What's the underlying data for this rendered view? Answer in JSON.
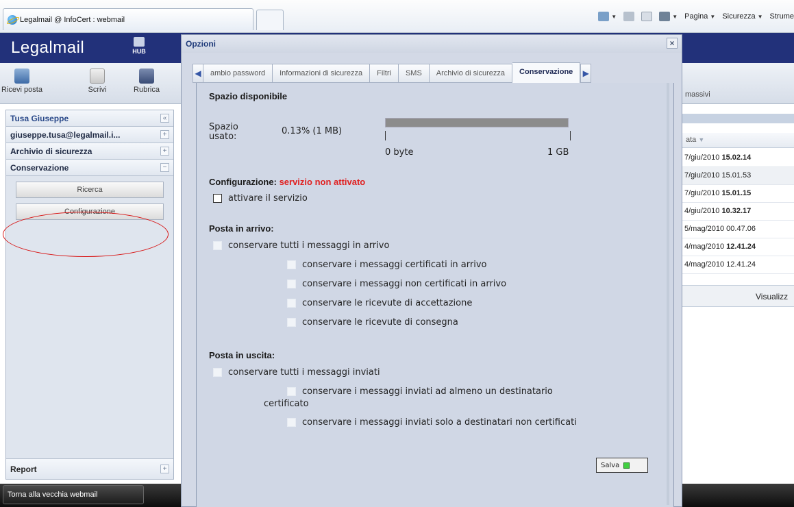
{
  "browser": {
    "tab_title": "Legalmail @ InfoCert : webmail",
    "commands": [
      "Pagina",
      "Sicurezza",
      "Strume"
    ]
  },
  "app": {
    "logo": "Legalmail",
    "hub_label": "HUB"
  },
  "toolbar": {
    "receive_label": "Ricevi posta",
    "write_label": "Scrivi",
    "contacts_label": "Rubrica",
    "massivi_label": "massivi"
  },
  "sidebar": {
    "user_name": "Tusa Giuseppe",
    "collapse_glyph": "«",
    "account": "giuseppe.tusa@legalmail.i...",
    "archive": "Archivio di sicurezza",
    "conservation": "Conservazione",
    "buttons": {
      "search": "Ricerca",
      "config": "Configurazione"
    },
    "report": "Report"
  },
  "taskbar": {
    "old_webmail": "Torna alla vecchia webmail"
  },
  "message_list": {
    "col_header": "ata",
    "rows": [
      {
        "date": "7/giu/2010",
        "time": "15.02.14",
        "bold": true
      },
      {
        "date": "7/giu/2010",
        "time": "15.01.53",
        "bold": false
      },
      {
        "date": "7/giu/2010",
        "time": "15.01.15",
        "bold": true
      },
      {
        "date": "4/giu/2010",
        "time": "10.32.17",
        "bold": true
      },
      {
        "date": "5/mag/2010",
        "time": "00.47.06",
        "bold": false
      },
      {
        "date": "4/mag/2010",
        "time": "12.41.24",
        "bold": true
      },
      {
        "date": "4/mag/2010",
        "time": "12.41.24",
        "bold": false
      }
    ],
    "visualizza": "Visualizz"
  },
  "modal": {
    "title": "Opzioni",
    "close_glyph": "×",
    "tabs": [
      {
        "label": "ambio password",
        "active": false
      },
      {
        "label": "Informazioni di sicurezza",
        "active": false
      },
      {
        "label": "Filtri",
        "active": false
      },
      {
        "label": "SMS",
        "active": false
      },
      {
        "label": "Archivio di sicurezza",
        "active": false
      },
      {
        "label": "Conservazione",
        "active": true
      }
    ],
    "space": {
      "title": "Spazio disponibile",
      "used_label_1": "Spazio",
      "used_label_2": "usato:",
      "used_value": "0.13% (1 MB)",
      "used_fraction": 0.0013,
      "min_label": "0 byte",
      "max_label": "1 GB"
    },
    "config": {
      "label": "Configurazione:",
      "status": "servizio non attivato",
      "status_color": "#e02020",
      "activate": "attivare il servizio"
    },
    "incoming": {
      "title": "Posta in arrivo:",
      "all": "conservare tutti i messaggi in arrivo",
      "certified": "conservare i messaggi certificati in arrivo",
      "non_certified": "conservare i messaggi non certificati in arrivo",
      "acceptance": "conservare le ricevute di accettazione",
      "delivery": "conservare le ricevute di consegna"
    },
    "outgoing": {
      "title": "Posta in uscita:",
      "all": "conservare tutti i messaggi inviati",
      "certified_line1": "conservare i messaggi inviati ad almeno un destinatario",
      "certified_line2": "certificato",
      "non_certified": "conservare i messaggi inviati solo a destinatari non certificati"
    },
    "save_label": "Salva"
  }
}
